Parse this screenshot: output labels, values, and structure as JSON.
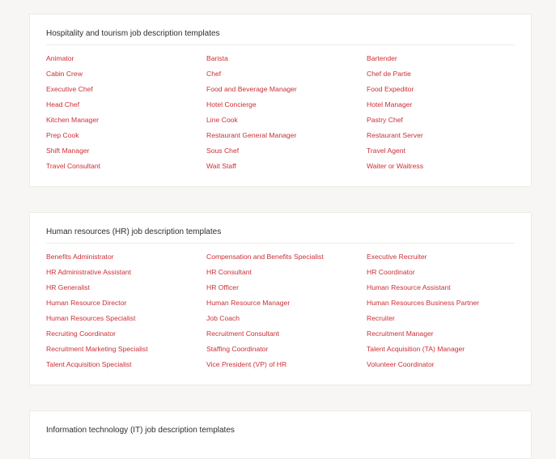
{
  "sections": [
    {
      "title": "Hospitality and tourism job description templates",
      "links": [
        "Animator",
        "Barista",
        "Bartender",
        "Cabin Crew",
        "Chef",
        "Chef de Partie",
        "Executive Chef",
        "Food and Beverage Manager",
        "Food Expeditor",
        "Head Chef",
        "Hotel Concierge",
        "Hotel Manager",
        "Kitchen Manager",
        "Line Cook",
        "Pastry Chef",
        "Prep Cook",
        "Restaurant General Manager",
        "Restaurant Server",
        "Shift Manager",
        "Sous Chef",
        "Travel Agent",
        "Travel Consultant",
        "Wait Staff",
        "Waiter or Waitress"
      ]
    },
    {
      "title": "Human resources (HR) job description templates",
      "links": [
        "Benefits Administrator",
        "Compensation and Benefits Specialist",
        "Executive Recruiter",
        "HR Administrative Assistant",
        "HR Consultant",
        "HR Coordinator",
        "HR Generalist",
        "HR Officer",
        "Human Resource Assistant",
        "Human Resource Director",
        "Human Resource Manager",
        "Human Resources Business Partner",
        "Human Resources Specialist",
        "Job Coach",
        "Recruiter",
        "Recruiting Coordinator",
        "Recruitment Consultant",
        "Recruitment Manager",
        "Recruitment Marketing Specialist",
        "Staffing Coordinator",
        "Talent Acquisition (TA) Manager",
        "Talent Acquisition Specialist",
        "Vice President (VP) of HR",
        "Volunteer Coordinator"
      ]
    },
    {
      "title": "Information technology (IT) job description templates",
      "links": []
    }
  ],
  "colors": {
    "link": "#cc2f36",
    "background": "#f7f6f4",
    "card": "#ffffff"
  }
}
